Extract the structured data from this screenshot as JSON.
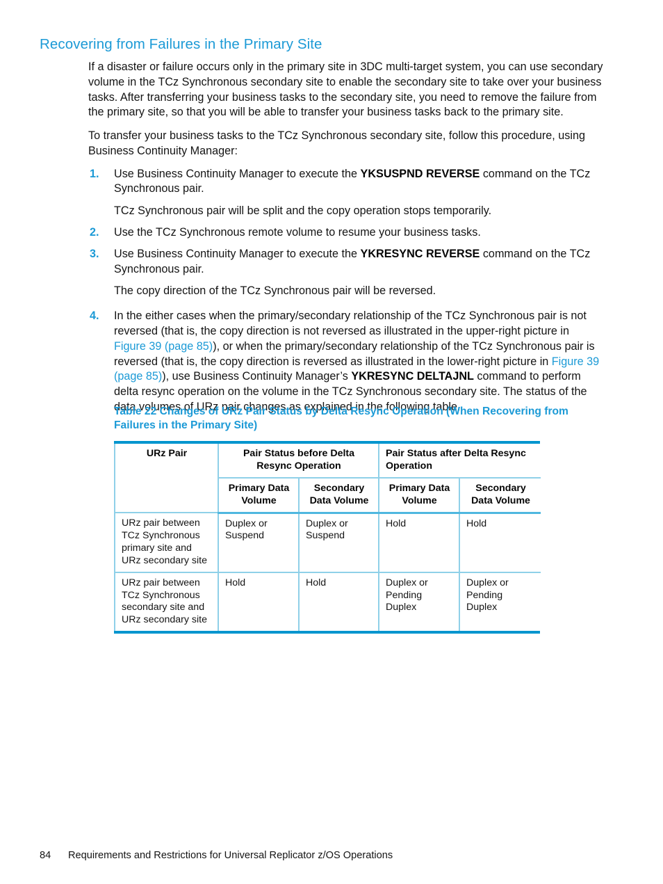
{
  "colors": {
    "accent_blue": "#1C9AD6",
    "rule_blue": "#0095CE",
    "cell_border_blue": "#8FD0E8",
    "body_text": "#141414"
  },
  "heading": "Recovering from Failures in the Primary Site",
  "paragraphs": {
    "intro": "If a disaster or failure occurs only in the primary site in 3DC multi-target system, you can use secondary volume in the TCz Synchronous secondary site to enable the secondary site to take over your business tasks. After transferring your business tasks to the secondary site, you need to remove the failure from the primary site, so that you will be able to transfer your business tasks back to the primary site.",
    "procedure_lead": "To transfer your business tasks to the TCz Synchronous secondary site, follow this procedure, using Business Continuity Manager:"
  },
  "steps": [
    {
      "number": "1.",
      "text_before": "Use Business Continuity Manager to execute the ",
      "command": "YKSUSPND REVERSE",
      "text_after": " command on the TCz Synchronous pair.",
      "result": "TCz Synchronous pair will be split and the copy operation stops temporarily."
    },
    {
      "number": "2.",
      "text_before": "Use the TCz Synchronous remote volume to resume your business tasks.",
      "command": "",
      "text_after": "",
      "result": ""
    },
    {
      "number": "3.",
      "text_before": "Use Business Continuity Manager to execute the ",
      "command": "YKRESYNC REVERSE",
      "text_after": " command on the TCz Synchronous pair.",
      "result": "The copy direction of the TCz Synchronous pair will be reversed."
    }
  ],
  "step4": {
    "number": "4.",
    "seg1": "In the either cases when the primary/secondary relationship of the TCz Synchronous pair is not reversed (that is, the copy direction is not reversed as illustrated in the upper-right picture in ",
    "link1": "Figure 39 (page 85)",
    "seg2": "), or when the primary/secondary relationship of the TCz Synchronous pair is reversed (that is, the copy direction is reversed as illustrated in the lower-right picture in ",
    "link2": "Figure 39 (page 85)",
    "seg3": "), use Business Continuity Manager’s ",
    "command": "YKRESYNC DELTAJNL",
    "seg4": " command to perform delta resync operation on the volume in the TCz Synchronous secondary site. The status of the data volumes of URz pair changes as explained in the following table."
  },
  "table": {
    "caption": "Table 22 Changes of URz Pair Status by Delta Resync Operation (When Recovering from Failures in the Primary Site)",
    "header_row1": {
      "col_urz": "URz Pair",
      "group_before": "Pair Status before Delta Resync Operation",
      "group_after": "Pair Status after Delta Resync Operation"
    },
    "header_row2": {
      "before_primary": "Primary Data Volume",
      "before_secondary": "Secondary Data Volume",
      "after_primary": "Primary Data Volume",
      "after_secondary": "Secondary Data Volume"
    },
    "rows": [
      {
        "urz_pair": "URz pair between TCz Synchronous primary site and URz secondary site",
        "before_primary": "Duplex or Suspend",
        "before_secondary": "Duplex or Suspend",
        "after_primary": "Hold",
        "after_secondary": "Hold"
      },
      {
        "urz_pair": "URz pair between TCz Synchronous secondary site and URz secondary site",
        "before_primary": "Hold",
        "before_secondary": "Hold",
        "after_primary": "Duplex or Pending Duplex",
        "after_secondary": "Duplex or Pending Duplex"
      }
    ]
  },
  "footer": {
    "page_number": "84",
    "running_title": "Requirements and Restrictions for Universal Replicator z/OS Operations"
  }
}
